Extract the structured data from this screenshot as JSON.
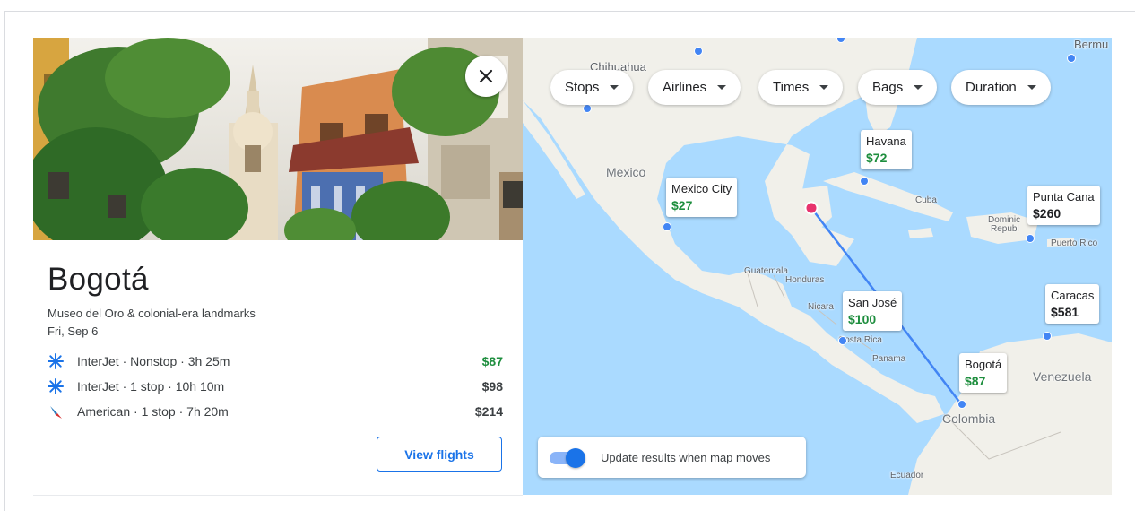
{
  "destination": {
    "city": "Bogotá",
    "subtitle": "Museo del Oro & colonial-era landmarks",
    "date": "Fri, Sep 6"
  },
  "flights": [
    {
      "airline_info": "InterJet · Nonstop · 3h 25m",
      "price": "$87",
      "logo": "interjet-icon",
      "cheapest": true
    },
    {
      "airline_info": "InterJet · 1 stop · 10h 10m",
      "price": "$98",
      "logo": "interjet-icon",
      "cheapest": false
    },
    {
      "airline_info": "American · 1 stop · 7h 20m",
      "price": "$214",
      "logo": "american-airlines-icon",
      "cheapest": false
    }
  ],
  "view_flights_label": "View flights",
  "filters": [
    "Stops",
    "Airlines",
    "Times",
    "Bags",
    "Duration"
  ],
  "map_pins": [
    {
      "city": "Havana",
      "price": "$72",
      "price_color": "green"
    },
    {
      "city": "Mexico City",
      "price": "$27",
      "price_color": "green"
    },
    {
      "city": "Punta Cana",
      "price": "$260",
      "price_color": "dark"
    },
    {
      "city": "San José",
      "price": "$100",
      "price_color": "green"
    },
    {
      "city": "Caracas",
      "price": "$581",
      "price_color": "dark"
    },
    {
      "city": "Bogotá",
      "price": "$87",
      "price_color": "green"
    }
  ],
  "map_labels": {
    "chihuahua": "Chihuahua",
    "bermuda": "Bermu",
    "mexico": "Mexico",
    "cuba": "Cuba",
    "dominican": "Dominic",
    "republic": "Republ",
    "puerto_rico": "Puerto Rico",
    "guatemala": "Guatemala",
    "honduras": "Honduras",
    "nicaragua": "Nicara",
    "costa_rica": "Costa Rica",
    "panama": "Panama",
    "venezuela": "Venezuela",
    "colombia": "Colombia",
    "ecuador": "Ecuador"
  },
  "update_toggle": {
    "label": "Update results when map moves",
    "on": true
  },
  "colors": {
    "accent": "#1a73e8",
    "price_green": "#1e8e3e",
    "origin_dot": "#e8336d",
    "route": "#4285f4",
    "water": "#aadaff",
    "land": "#f1f0ea"
  }
}
